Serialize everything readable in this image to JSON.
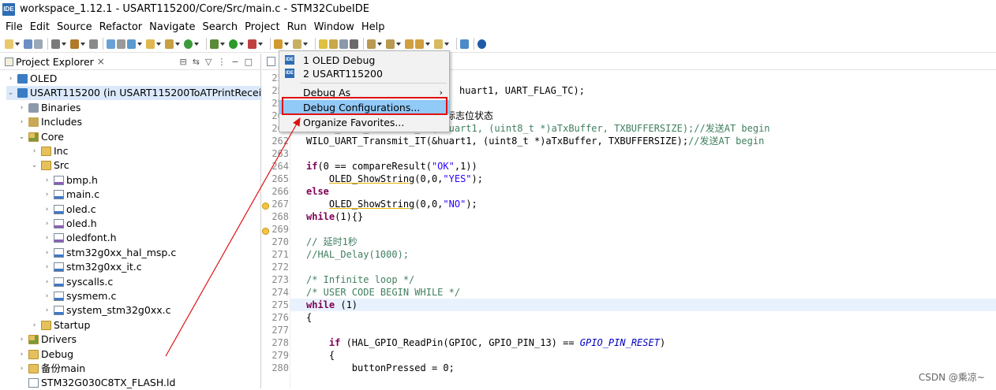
{
  "window": {
    "title": "workspace_1.12.1 - USART115200/Core/Src/main.c - STM32CubeIDE",
    "logo_text": "IDE"
  },
  "menubar": [
    "File",
    "Edit",
    "Source",
    "Refactor",
    "Navigate",
    "Search",
    "Project",
    "Run",
    "Window",
    "Help"
  ],
  "explorer": {
    "title": "Project Explorer",
    "close": "×",
    "items": [
      {
        "label": "OLED",
        "twisty": "›",
        "icon": "project-icon"
      },
      {
        "label": "USART115200 (in USART115200ToATPrintReceive",
        "twisty": "⌄",
        "icon": "project-icon"
      },
      {
        "label": "Binaries",
        "twisty": "›",
        "icon": "binaries-icon"
      },
      {
        "label": "Includes",
        "twisty": "›",
        "icon": "includes-icon"
      },
      {
        "label": "Core",
        "twisty": "⌄",
        "icon": "source-folder-icon"
      },
      {
        "label": "Inc",
        "twisty": "›",
        "icon": "folder-icon"
      },
      {
        "label": "Src",
        "twisty": "⌄",
        "icon": "folder-icon"
      },
      {
        "label": "bmp.h",
        "twisty": "›",
        "icon": "h-file-icon"
      },
      {
        "label": "main.c",
        "twisty": "›",
        "icon": "c-file-icon"
      },
      {
        "label": "oled.c",
        "twisty": "›",
        "icon": "c-file-icon"
      },
      {
        "label": "oled.h",
        "twisty": "›",
        "icon": "h-file-icon"
      },
      {
        "label": "oledfont.h",
        "twisty": "›",
        "icon": "h-file-icon"
      },
      {
        "label": "stm32g0xx_hal_msp.c",
        "twisty": "›",
        "icon": "c-file-icon"
      },
      {
        "label": "stm32g0xx_it.c",
        "twisty": "›",
        "icon": "c-file-icon"
      },
      {
        "label": "syscalls.c",
        "twisty": "›",
        "icon": "c-file-icon"
      },
      {
        "label": "sysmem.c",
        "twisty": "›",
        "icon": "c-file-icon"
      },
      {
        "label": "system_stm32g0xx.c",
        "twisty": "›",
        "icon": "c-file-icon"
      },
      {
        "label": "Startup",
        "twisty": "›",
        "icon": "folder-icon"
      },
      {
        "label": "Drivers",
        "twisty": "›",
        "icon": "source-folder-icon"
      },
      {
        "label": "Debug",
        "twisty": "›",
        "icon": "folder-icon"
      },
      {
        "label": "备份main",
        "twisty": "›",
        "icon": "folder-icon"
      },
      {
        "label": "STM32G030C8TX_FLASH.ld",
        "twisty": "",
        "icon": "file-icon"
      }
    ]
  },
  "debug_menu": {
    "items": [
      {
        "label": "1 OLED Debug",
        "icon": "ide-icon"
      },
      {
        "label": "2 USART115200",
        "icon": "ide-icon"
      },
      {
        "label": "Debug As",
        "arrow": "›"
      },
      {
        "label": "Debug Configurations...",
        "highlighted": true
      },
      {
        "label": "Organize Favorites..."
      }
    ],
    "highlight_color": "#91c9f7"
  },
  "editor": {
    "lines": [
      {
        "n": "257",
        "text": ""
      },
      {
        "n": "258",
        "text": "huart1, UART_FLAG_TC);"
      },
      {
        "n": "259",
        "text": ""
      },
      {
        "n": "260",
        "text": "标志位状态"
      },
      {
        "n": "261",
        "text": "//HAL_UART_Transmit_IT(&huart1, (uint8_t *)aTxBuffer, TXBUFFERSIZE);//发送AT begin"
      },
      {
        "n": "262",
        "text": "WILO_UART_Transmit_IT(&huart1, (uint8_t *)aTxBuffer, TXBUFFERSIZE);//发送AT begin"
      },
      {
        "n": "263",
        "text": ""
      },
      {
        "n": "264",
        "text": "if(0 == compareResult(\"OK\",1))"
      },
      {
        "n": "265",
        "text": "    OLED_ShowString(0,0,\"YES\");"
      },
      {
        "n": "266",
        "text": "else"
      },
      {
        "n": "267",
        "text": "    OLED_ShowString(0,0,\"NO\");"
      },
      {
        "n": "268",
        "text": "while(1){}"
      },
      {
        "n": "269",
        "text": ""
      },
      {
        "n": "270",
        "text": "// 延时1秒"
      },
      {
        "n": "271",
        "text": "//HAL_Delay(1000);"
      },
      {
        "n": "272",
        "text": ""
      },
      {
        "n": "273",
        "text": "/* Infinite loop */"
      },
      {
        "n": "274",
        "text": "/* USER CODE BEGIN WHILE */"
      },
      {
        "n": "275",
        "text": "while (1)"
      },
      {
        "n": "276",
        "text": "{"
      },
      {
        "n": "277",
        "text": ""
      },
      {
        "n": "278",
        "text": "    if (HAL_GPIO_ReadPin(GPIOC, GPIO_PIN_13) == GPIO_PIN_RESET)"
      },
      {
        "n": "279",
        "text": "    {"
      },
      {
        "n": "280",
        "text": "        buttonPressed = 0;"
      }
    ]
  },
  "watermark": "CSDN @乘凉~",
  "colors": {
    "annotation_red": "#e01010",
    "keyword": "#7f0055",
    "comment": "#3f7f5f",
    "string": "#2a00ff"
  }
}
